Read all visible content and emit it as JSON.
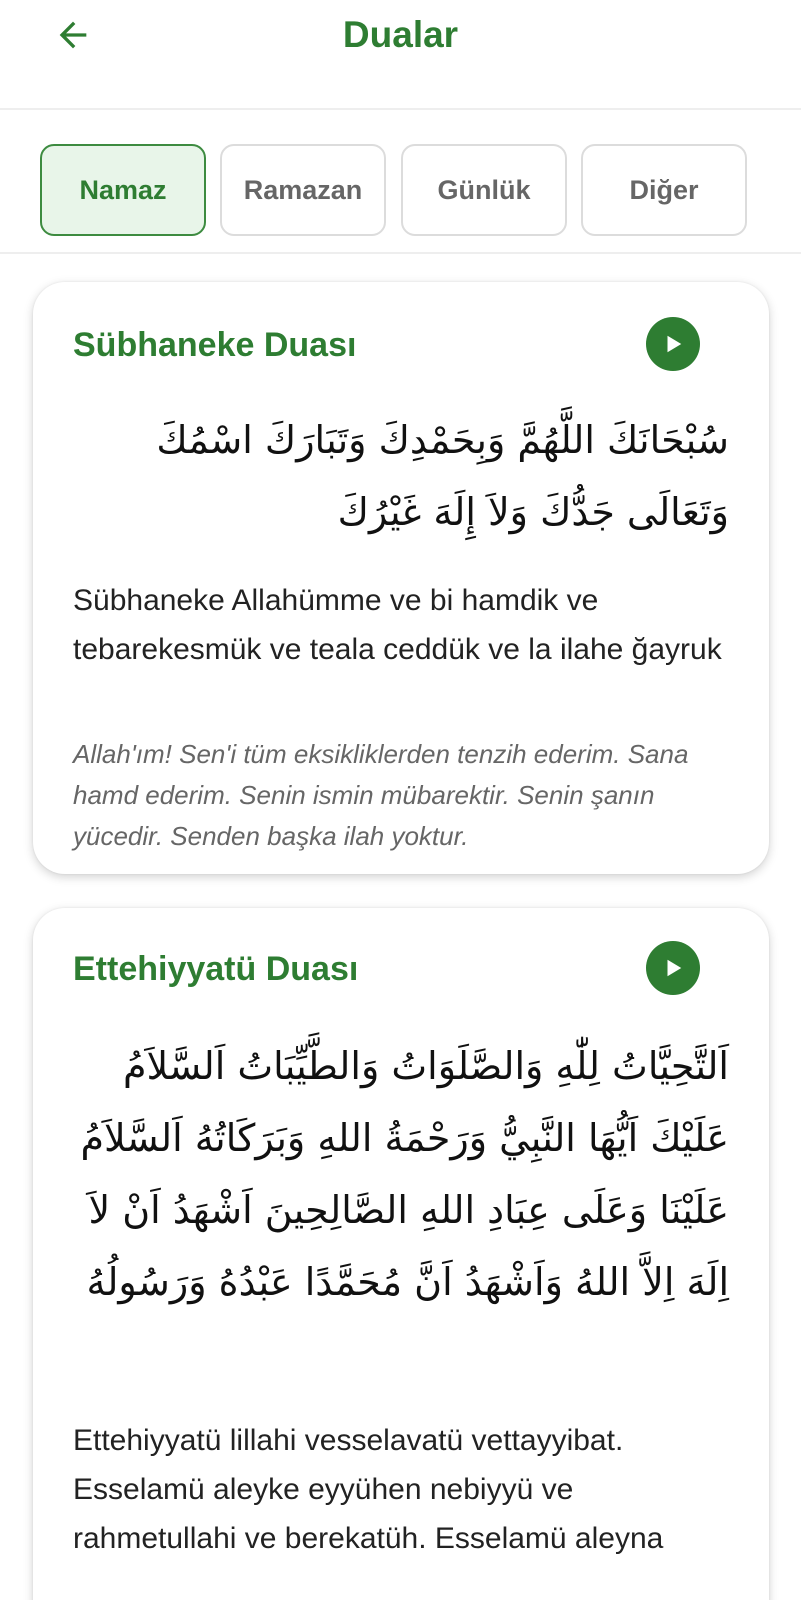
{
  "header": {
    "title": "Dualar",
    "back_icon": "arrow-left-icon"
  },
  "tabs": [
    {
      "label": "Namaz",
      "active": true
    },
    {
      "label": "Ramazan",
      "active": false
    },
    {
      "label": "Günlük",
      "active": false
    },
    {
      "label": "Diğer",
      "active": false
    }
  ],
  "duas": [
    {
      "title": "Sübhaneke Duası",
      "arabic": "سُبْحَانَكَ اللَّهُمَّ وَبِحَمْدِكَ وَتَبَارَكَ اسْمُكَ وَتَعَالَى جَدُّكَ وَلاَ إِلَهَ غَيْرُكَ",
      "transliteration": "Sübhaneke Allahümme ve bi hamdik ve tebarekesmük ve teala ceddük ve la ilahe ğayruk",
      "meaning": "Allah'ım! Sen'i tüm eksikliklerden tenzih ederim. Sana hamd ederim. Senin ismin mübarektir. Senin şanın yücedir. Senden başka ilah yoktur."
    },
    {
      "title": "Ettehiyyatü Duası",
      "arabic": "اَلتَّحِيَّاتُ لِلّٰهِ وَالصَّلَوَاتُ وَالطَّيِّبَاتُ اَلسَّلاَمُ عَلَيْكَ اَيُّهَا النَّبِيُّ وَرَحْمَةُ اللهِ وَبَرَكَاتُهُ اَلسَّلاَمُ عَلَيْنَا وَعَلَى عِبَادِ اللهِ الصَّالِحِينَ اَشْهَدُ اَنْ لاَ اِلَهَ اِلاَّ اللهُ وَاَشْهَدُ اَنَّ مُحَمَّدًا عَبْدُهُ وَرَسُولُهُ",
      "transliteration": "Ettehiyyatü lillahi vesselavatü vettayyibat. Esselamü aleyke eyyühen nebiyyü ve rahmetullahi ve berekatüh. Esselamü aleyna"
    }
  ],
  "colors": {
    "accent": "#2e7d32",
    "tab_active_bg": "#e8f5e9",
    "meaning_text": "#666666"
  }
}
